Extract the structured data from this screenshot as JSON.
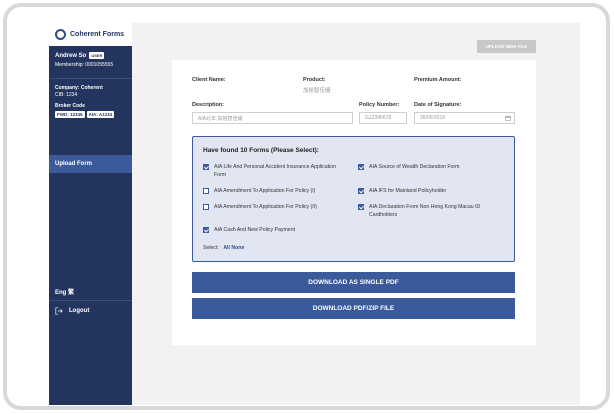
{
  "sidebar": {
    "brand": "Coherent Forms",
    "user_name": "Andrew So",
    "user_badge": "USER",
    "membership": "Membership: 0001055555",
    "company_label": "Company: Coherent",
    "cib": "CIB: 1234",
    "broker_label": "Broker Code",
    "broker_tags": [
      "FWD: 12345",
      "AIA: A1234"
    ],
    "nav_upload": "Upload Form",
    "language": "Eng 繁",
    "logout": "Logout"
  },
  "toolbar": {
    "upload_new_file": "UPLOAD NEW FILE"
  },
  "form": {
    "client_name_label": "Client Name:",
    "product_label": "Product:",
    "product_value": "加裕智佳儲",
    "premium_label": "Premium Amount:",
    "description_label": "Description:",
    "description_value": "AIA北年 加裕智佳儲",
    "policy_number_label": "Policy Number:",
    "policy_number_value": "G12345678",
    "date_label": "Date of Signature:",
    "date_value": "26/09/2018"
  },
  "forms_box": {
    "title": "Have found 10 Forms (Please Select):",
    "left_options": [
      {
        "label": "AIA Life And Personal Accident Insurance Application Form",
        "checked": true
      },
      {
        "label": "AIA Amendment To Application For Policy (I)",
        "checked": false
      },
      {
        "label": "AIA Amendment To Application For Policy (II)",
        "checked": false
      },
      {
        "label": "AIA Cash And New Policy Payment",
        "checked": true
      }
    ],
    "right_options": [
      {
        "label": "AIA Source of Wealth Declaration Form",
        "checked": true
      },
      {
        "label": "AIA IFS for Mainland Policyholder",
        "checked": true
      },
      {
        "label": "AIA Declaration From Non Hong Kong Macau ID Cardholders",
        "checked": true
      }
    ],
    "select_label": "Select:",
    "select_all_none": "All None"
  },
  "actions": {
    "download_single": "DOWNLOAD AS SINGLE PDF",
    "download_zip": "DOWNLOAD PDF/ZIP FILE"
  },
  "colors": {
    "sidebar_bg": "#23355e",
    "accent": "#3a5a9b",
    "forms_box_bg": "#e1e6f2"
  }
}
